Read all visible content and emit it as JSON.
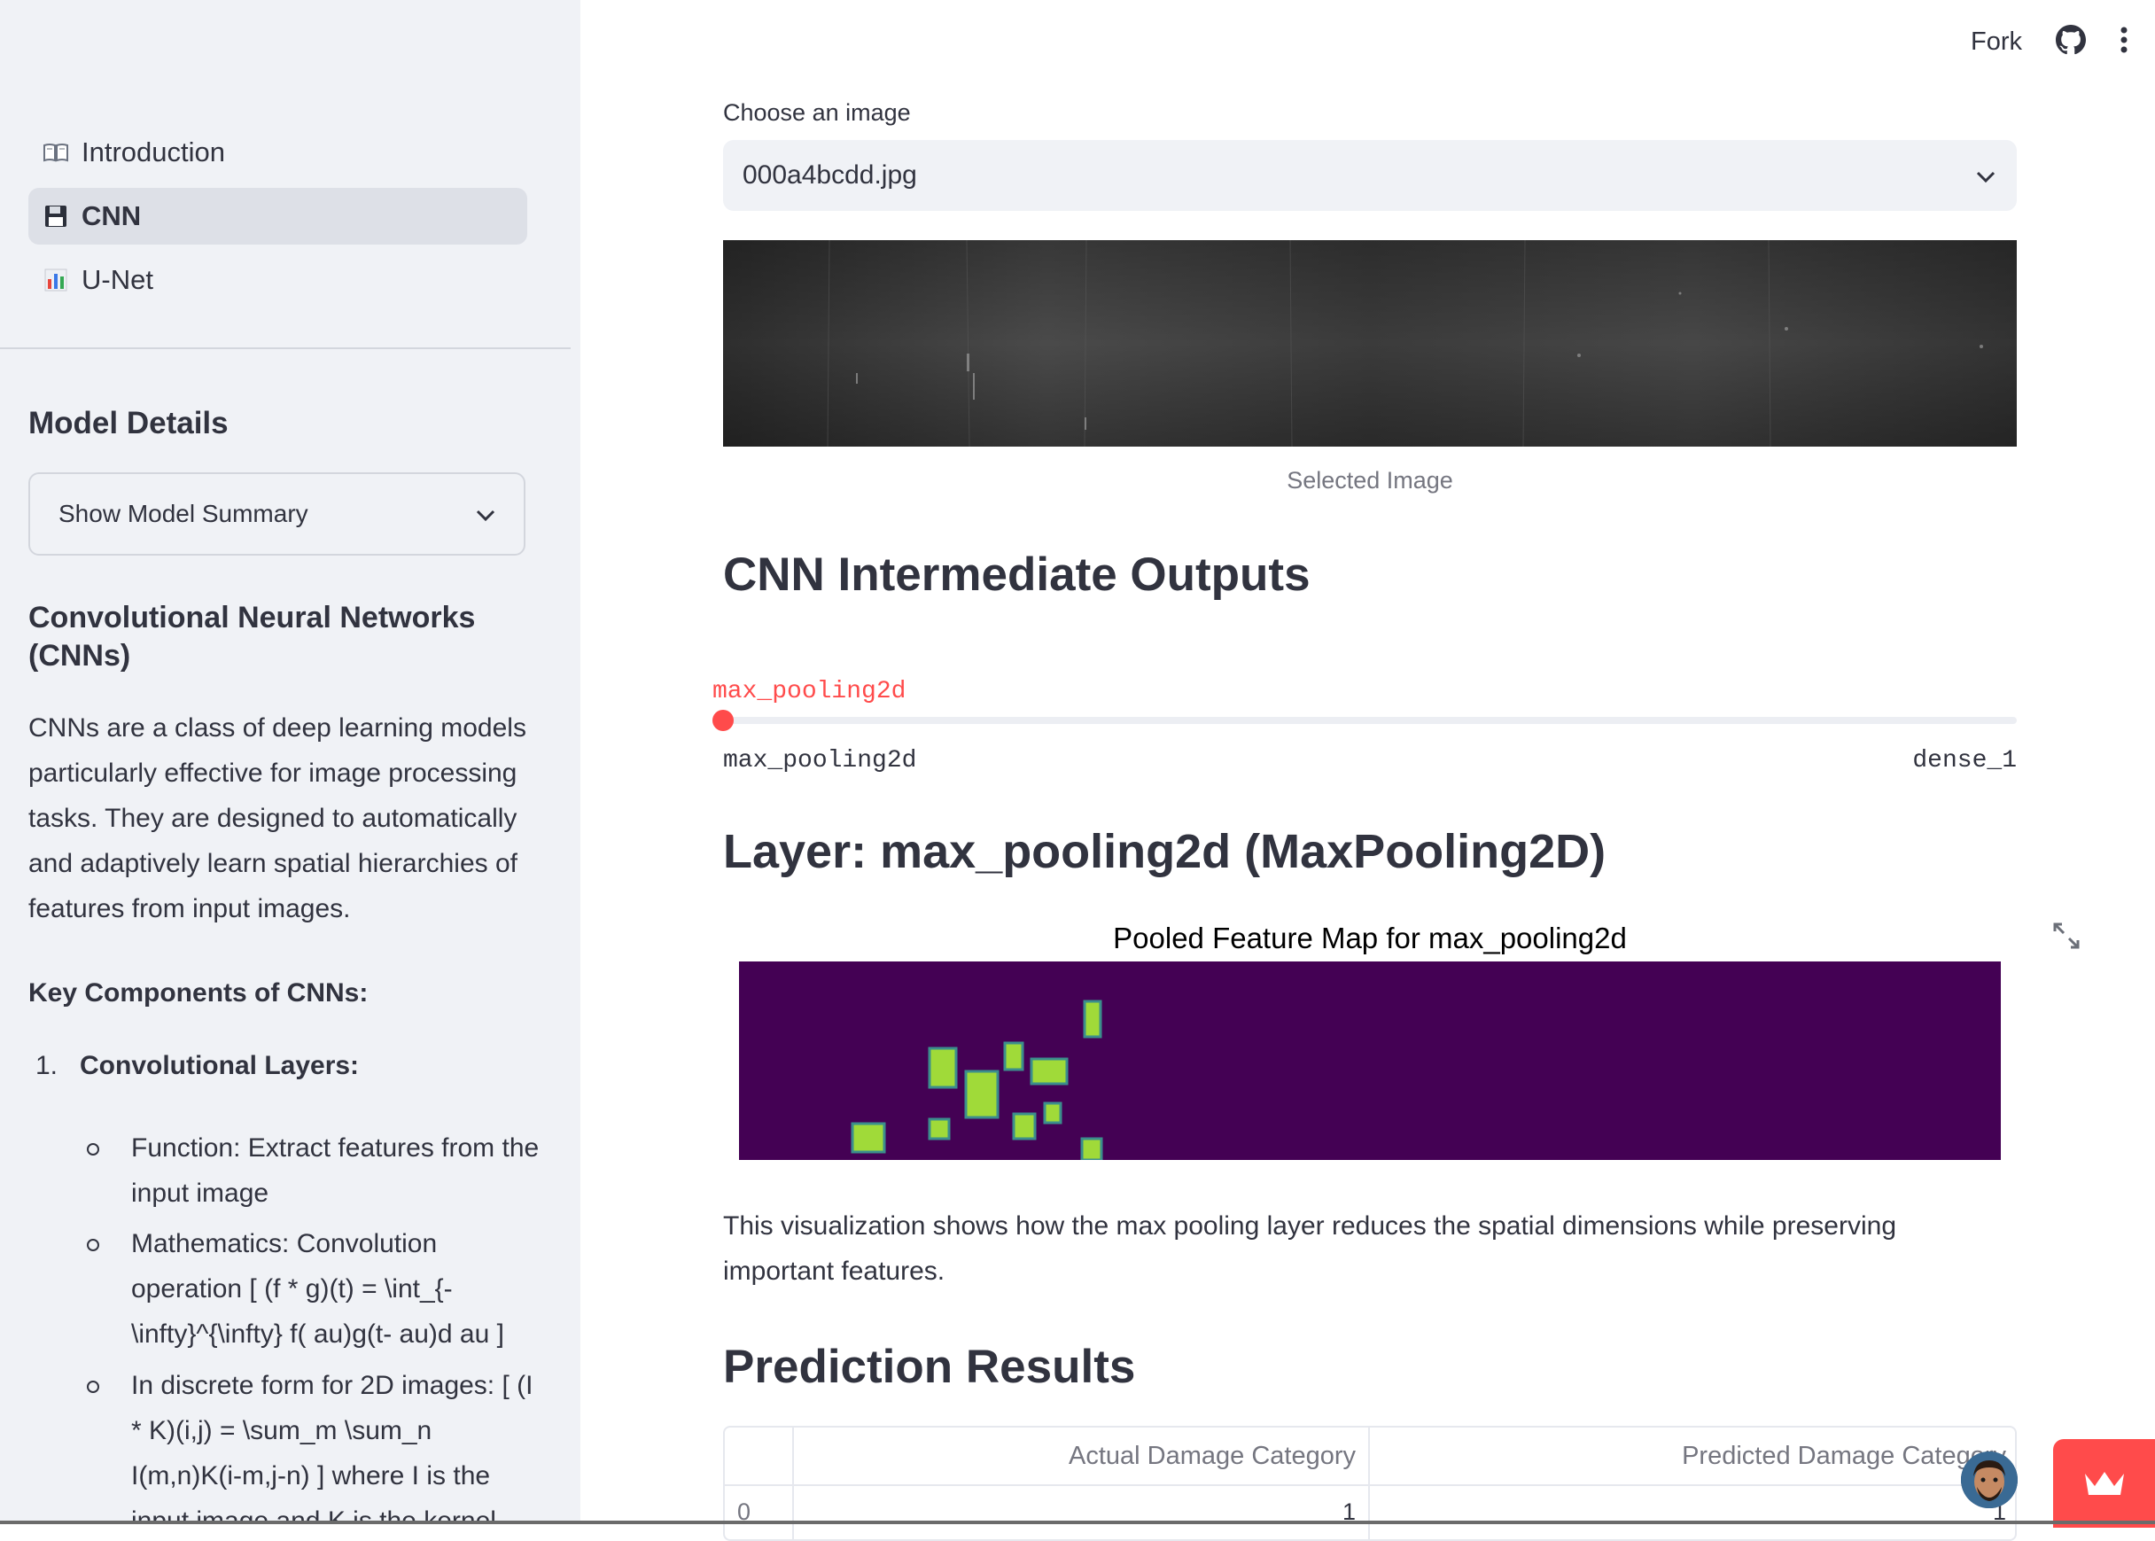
{
  "sidebar": {
    "nav": [
      {
        "label": "Introduction",
        "icon": "book-icon",
        "active": false
      },
      {
        "label": "CNN",
        "icon": "floppy-disk-icon",
        "active": true
      },
      {
        "label": "U-Net",
        "icon": "bar-chart-icon",
        "active": false
      }
    ],
    "model_details_heading": "Model Details",
    "summary_select": "Show Model Summary",
    "cnn_heading": "Convolutional Neural Networks (CNNs)",
    "cnn_paragraph": "CNNs are a class of deep learning models particularly effective for image processing tasks. They are designed to automatically and adaptively learn spatial hierarchies of features from input images.",
    "key_components_heading": "Key Components of CNNs:",
    "list_number": "1.",
    "list_item_label": "Convolutional Layers:",
    "sub_items": [
      "Function: Extract features from the input image",
      "Mathematics: Convolution operation [ (f * g)(t) = \\int_{-\\infty}^{\\infty} f( au)g(t- au)d au ]",
      "In discrete form for 2D images: [ (I * K)(i,j) = \\sum_m \\sum_n I(m,n)K(i-m,j-n) ] where I is the input image and K is the kernel"
    ]
  },
  "header": {
    "fork_label": "Fork",
    "github_icon": "github-icon",
    "menu_icon": "kebab-menu-icon"
  },
  "main": {
    "choose_label": "Choose an image",
    "selected_file": "000a4bcdd.jpg",
    "image_caption": "Selected Image",
    "intermediate_heading": "CNN Intermediate Outputs",
    "slider": {
      "current": "max_pooling2d",
      "min_label": "max_pooling2d",
      "max_label": "dense_1",
      "position_fraction": 0
    },
    "layer_heading": "Layer: max_pooling2d (MaxPooling2D)",
    "figure_title": "Pooled Feature Map for max_pooling2d",
    "visualization_text": "This visualization shows how the max pooling layer reduces the spatial dimensions while preserving important features.",
    "prediction_heading": "Prediction Results",
    "table": {
      "columns": [
        "",
        "Actual Damage Category",
        "Predicted Damage Category"
      ],
      "rows": [
        [
          "0",
          "1",
          "1"
        ]
      ]
    }
  },
  "colors": {
    "accent": "#ff4b4b",
    "sidebar_bg": "#f0f2f6",
    "text": "#31333f",
    "heatmap_bg": "#440154",
    "heatmap_hot": "#a0da39"
  }
}
